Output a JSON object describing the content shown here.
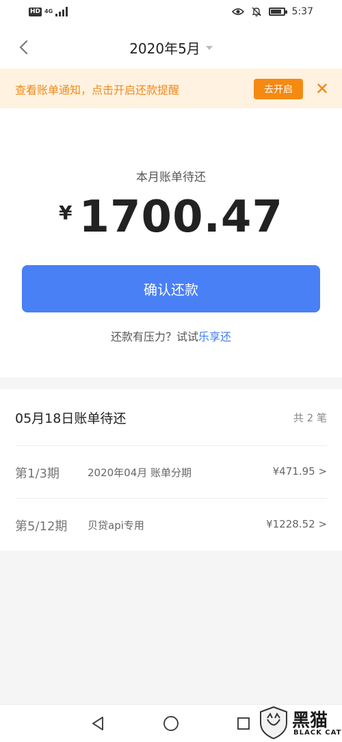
{
  "status_bar": {
    "hd": "HD",
    "network": "4G",
    "time": "5:37",
    "battery_level": 0.85
  },
  "nav": {
    "title": "2020年5月"
  },
  "notice": {
    "text": "查看账单通知，点击开启还款提醒",
    "button": "去开启"
  },
  "summary": {
    "label": "本月账单待还",
    "currency": "¥",
    "amount": "1700.47",
    "confirm_button": "确认还款",
    "pressure_text": "还款有压力？试试",
    "pressure_link": "乐享还"
  },
  "bill": {
    "title": "05月18日账单待还",
    "count": "共 2 笔",
    "rows": [
      {
        "period": "第1/3期",
        "desc": "2020年04月 账单分期",
        "amount": "¥471.95 >"
      },
      {
        "period": "第5/12期",
        "desc": "贝贷api专用",
        "amount": "¥1228.52 >"
      }
    ]
  },
  "watermark": {
    "title": "黑猫",
    "subtitle": "BLACK CAT"
  },
  "colors": {
    "accent": "#4a80f5",
    "notice_bg": "#fff2e0",
    "notice_text": "#f08a1d",
    "notice_button": "#f58a12"
  }
}
